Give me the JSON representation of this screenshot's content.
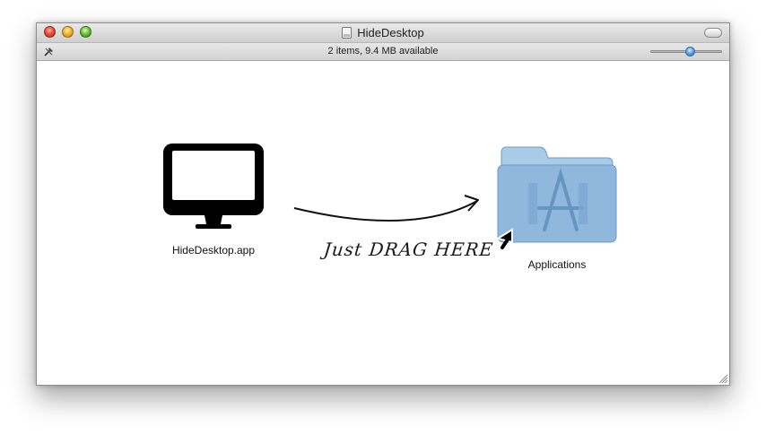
{
  "window": {
    "title": "HideDesktop",
    "status": "2 items, 9.4 MB available",
    "slider_level": 0.55
  },
  "items": [
    {
      "label": "HideDesktop.app",
      "icon": "monitor-icon"
    },
    {
      "label": "Applications",
      "icon": "applications-folder-icon"
    }
  ],
  "instruction": "Just DRAG HERE",
  "colors": {
    "folder": "#8fb8dc",
    "folder_tab": "#a9cbe8",
    "monitor": "#000000"
  }
}
